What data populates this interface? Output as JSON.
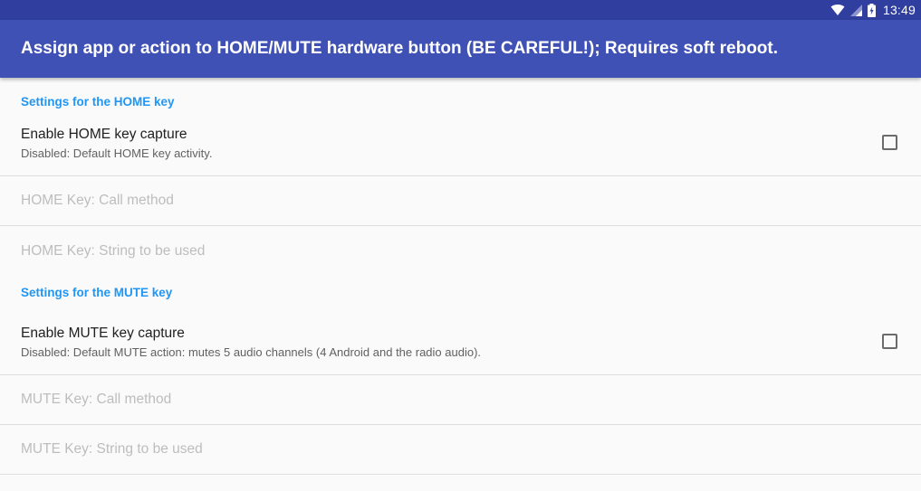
{
  "status_bar": {
    "time": "13:49",
    "icons": [
      "wifi-icon",
      "signal-icon",
      "battery-charging-icon"
    ]
  },
  "app_bar": {
    "title": "Assign app or action to HOME/MUTE hardware button (BE CAREFUL!); Requires soft reboot."
  },
  "home_section": {
    "header": "Settings for the HOME key",
    "enable": {
      "title": "Enable HOME key capture",
      "summary": "Disabled: Default HOME key activity.",
      "checked": false
    },
    "call_method": {
      "title": "HOME Key: Call method"
    },
    "string_used": {
      "title": "HOME Key: String to be used"
    }
  },
  "mute_section": {
    "header": "Settings for the MUTE key",
    "enable": {
      "title": "Enable MUTE key capture",
      "summary": "Disabled: Default MUTE action: mutes 5 audio channels (4 Android and the radio audio).",
      "checked": false
    },
    "call_method": {
      "title": "MUTE Key: Call method"
    },
    "string_used": {
      "title": "MUTE Key: String to be used"
    }
  },
  "colors": {
    "status_bar": "#303f9f",
    "app_bar": "#3f51b5",
    "accent": "#2196f3",
    "background": "#fafafa"
  }
}
